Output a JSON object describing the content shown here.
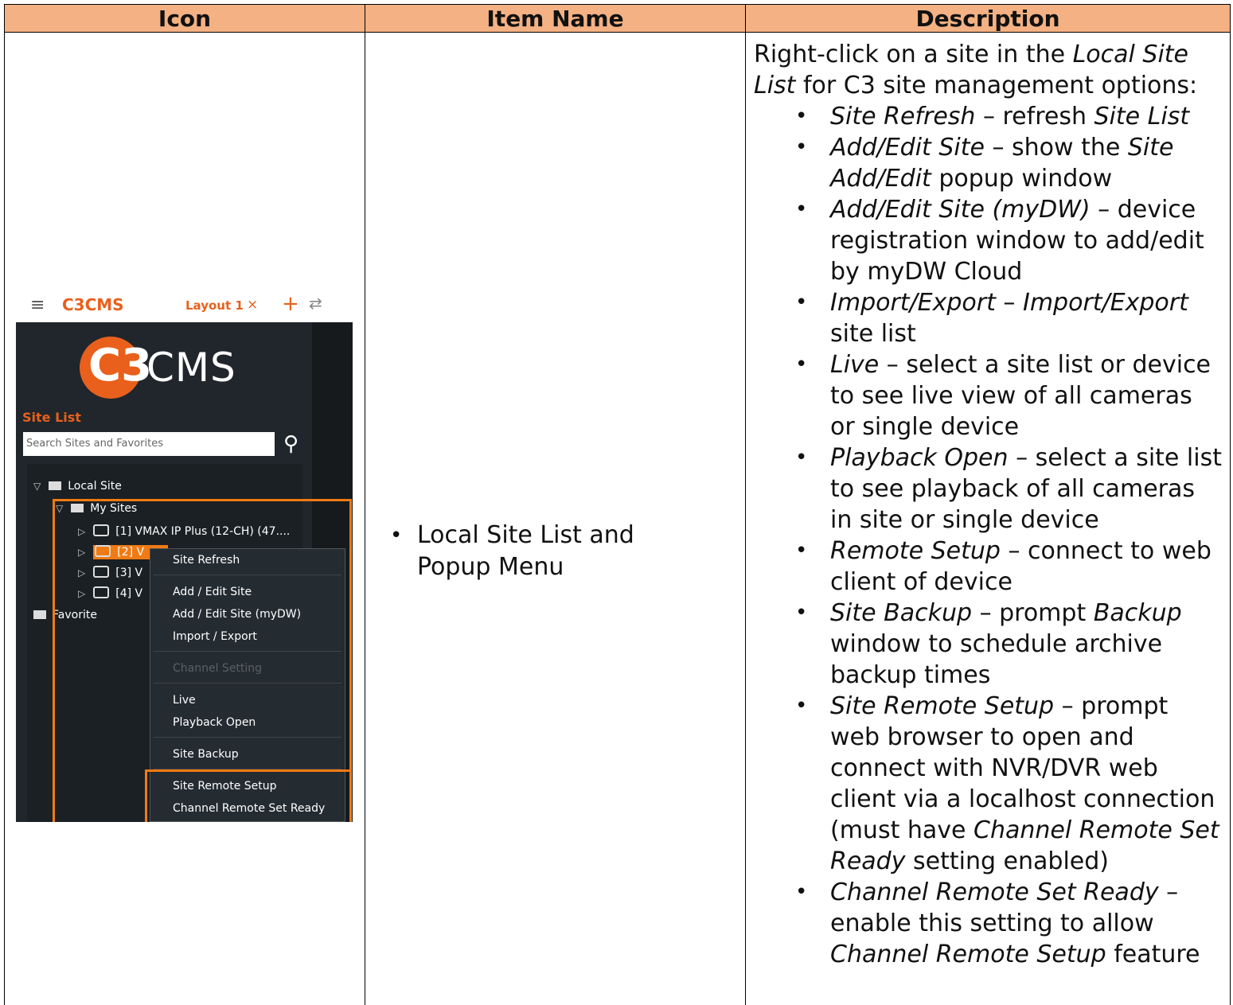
{
  "headers": [
    "Icon",
    "Item Name",
    "Description"
  ],
  "item_name": "Local Site List and Popup Menu",
  "screenshot": {
    "app_name": "C3CMS",
    "layout_tab": "Layout 1",
    "layout_close": "×",
    "logo_c3": "C3",
    "logo_cms": "CMS",
    "site_list_label": "Site List",
    "search_placeholder": "Search Sites and Favorites",
    "tree": {
      "local_site": "Local Site",
      "my_sites": "My Sites",
      "devices": [
        "[1] VMAX IP Plus (12-CH) (47....",
        "[2] V",
        "[3] V",
        "[4] V"
      ],
      "favorite": "Favorite"
    },
    "menu": [
      "Site Refresh",
      "Add / Edit Site",
      "Add / Edit Site (myDW)",
      "Import / Export",
      "Channel Setting",
      "Live",
      "Playback Open",
      "Site Backup",
      "Site Remote Setup",
      "Channel Remote Set Ready"
    ]
  },
  "description": {
    "intro_pre": "Right-click on a site in the ",
    "intro_em": "Local Site List",
    "intro_post": " for C3 site management options:",
    "items": [
      {
        "term": "Site Refresh",
        "text": " – refresh ",
        "em2": "Site List",
        "tail": ""
      },
      {
        "term": "Add/Edit Site",
        "text": " – show the ",
        "em2": "Site Add/Edit",
        "tail": " popup window"
      },
      {
        "term": "Add/Edit Site (myDW)",
        "text": " – device registration window to add/edit by myDW Cloud",
        "em2": "",
        "tail": ""
      },
      {
        "term": "Import/Export",
        "text": " – ",
        "em2": "Import/Export",
        "tail": " site list"
      },
      {
        "term": "Live",
        "text": " – select a site list or device to see live view of all cameras or single device",
        "em2": "",
        "tail": ""
      },
      {
        "term": "Playback Open",
        "text": " – select a site list to see playback of all cameras in site or single device",
        "em2": "",
        "tail": ""
      },
      {
        "term": "Remote Setup",
        "text": " – connect to web client of device",
        "em2": "",
        "tail": ""
      },
      {
        "term": "Site Backup",
        "text": " – prompt ",
        "em2": "Backup",
        "tail": " window to schedule archive backup times"
      },
      {
        "term": "Site Remote Setup",
        "text": " – prompt web browser to open and connect with NVR/DVR web client via a localhost connection (must have ",
        "em2": "Channel Remote Set Ready",
        "tail": " setting enabled)"
      },
      {
        "term": "Channel Remote Set Ready",
        "text": " – enable this setting to allow ",
        "em2": "Channel Remote Setup",
        "tail": " feature"
      }
    ]
  }
}
